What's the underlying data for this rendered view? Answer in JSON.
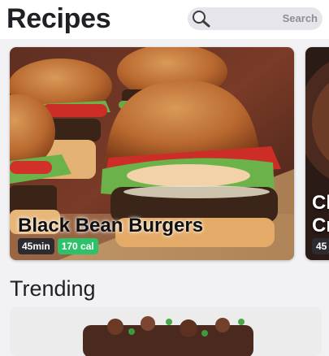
{
  "header": {
    "title": "Recipes",
    "search": {
      "placeholder": "Search",
      "icon": "search-icon"
    }
  },
  "featured": [
    {
      "title": "Black Bean Burgers",
      "time": "45min",
      "calories": "170 cal"
    },
    {
      "title": "Ch\nCr",
      "time": "45"
    }
  ],
  "trending": {
    "title": "Trending"
  },
  "colors": {
    "calorie_badge": "#2fc16a",
    "time_badge": "#2b2b30",
    "background": "#f2f2f4"
  }
}
